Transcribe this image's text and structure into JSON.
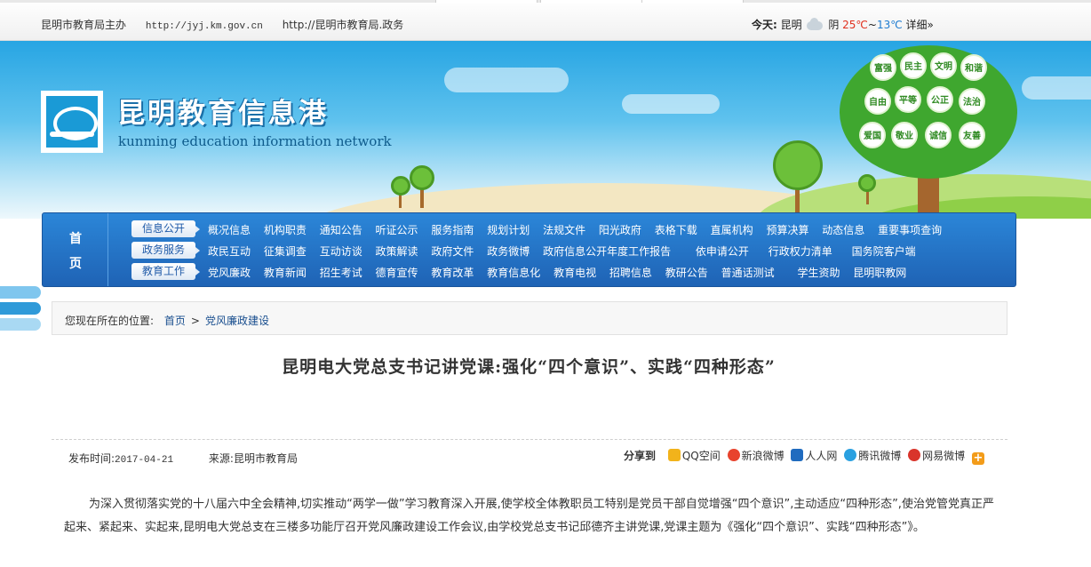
{
  "topbar": {
    "host": "昆明市教育局主办",
    "url1": "http://jyj.km.gov.cn",
    "url2": "http://昆明市教育局.政务",
    "weather": {
      "label": "今天:",
      "city": "昆明",
      "icon": "cloud-icon",
      "condition": "阴",
      "high": "25℃",
      "sep": "~",
      "low": "13℃",
      "detail": "详细»"
    }
  },
  "banner": {
    "brand_cn": "昆明教育信息港",
    "brand_en": "kunming education information network",
    "values": [
      {
        "cn": "富强"
      },
      {
        "cn": "民主"
      },
      {
        "cn": "文明"
      },
      {
        "cn": "和谐"
      },
      {
        "cn": "自由"
      },
      {
        "cn": "平等"
      },
      {
        "cn": "公正"
      },
      {
        "cn": "法治"
      },
      {
        "cn": "爱国"
      },
      {
        "cn": "敬业"
      },
      {
        "cn": "诚信"
      },
      {
        "cn": "友善"
      }
    ]
  },
  "nav": {
    "home_1": "首",
    "home_2": "页",
    "rows": [
      {
        "cat": "信息公开",
        "links": [
          "概况信息",
          "机构职责",
          "通知公告",
          "听证公示",
          "服务指南",
          "规划计划",
          "法规文件",
          "阳光政府",
          "表格下载",
          "直属机构",
          "预算决算",
          "动态信息",
          "重要事项查询"
        ]
      },
      {
        "cat": "政务服务",
        "links": [
          "政民互动",
          "征集调查",
          "互动访谈",
          "政策解读",
          "政府文件",
          "政务微博",
          "政府信息公开年度工作报告",
          "依申请公开",
          "行政权力清单",
          "国务院客户端"
        ]
      },
      {
        "cat": "教育工作",
        "links": [
          "党风廉政",
          "教育新闻",
          "招生考试",
          "德育宣传",
          "教育改革",
          "教育信息化",
          "教育电视",
          "招聘信息",
          "教研公告",
          "普通话测试",
          "学生资助",
          "昆明职教网"
        ]
      }
    ]
  },
  "breadcrumb": {
    "prefix": "您现在所在的位置:",
    "home": "首页",
    "arrow": ">",
    "current": "党风廉政建设"
  },
  "article": {
    "title": "昆明电大党总支书记讲党课:强化“四个意识”、实践“四种形态”",
    "date_label": "发布时间:",
    "date": "2017-04-21",
    "source_label": "来源:",
    "source": "昆明市教育局",
    "share_label": "分享到",
    "share": [
      "QQ空间",
      "新浪微博",
      "人人网",
      "腾讯微博",
      "网易微博"
    ],
    "share_more": "+",
    "body": "为深入贯彻落实党的十八届六中全会精神,切实推动“两学一做”学习教育深入开展,使学校全体教职员工特别是党员干部自觉增强“四个意识”,主动适应“四种形态”,使治党管党真正严起来、紧起来、实起来,昆明电大党总支在三楼多功能厅召开党风廉政建设工作会议,由学校党总支书记邱德齐主讲党课,党课主题为《强化“四个意识”、实践“四种形态”》。"
  }
}
